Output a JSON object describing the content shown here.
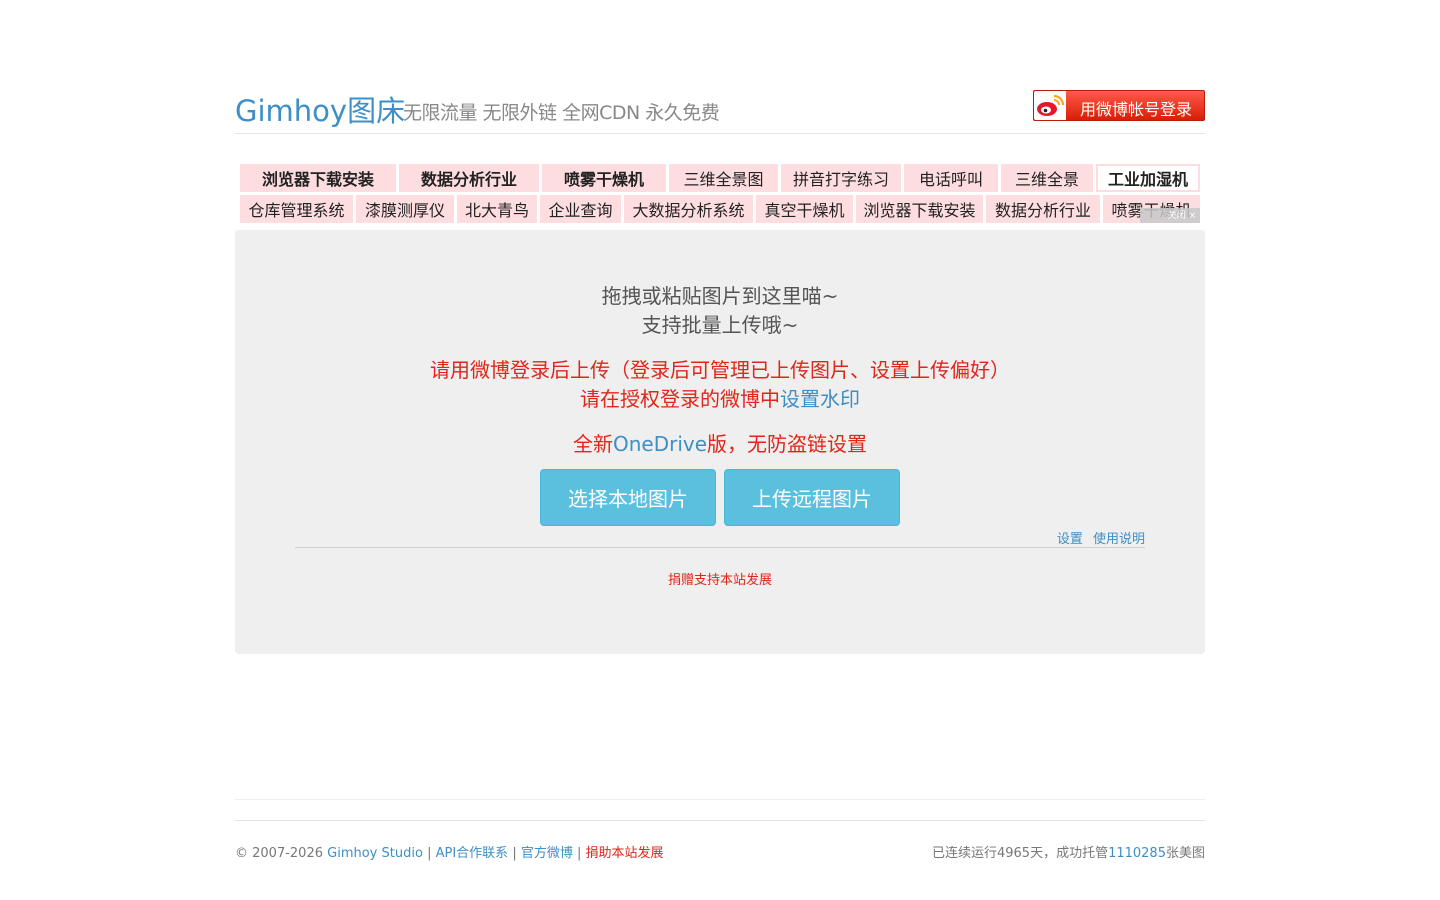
{
  "header": {
    "brand": "Gimhoy图床",
    "slogan": "无限流量 无限外链 全网CDN 永久免费",
    "login_button": "用微博帐号登录"
  },
  "ads": {
    "row1": [
      "浏览器下载安装",
      "数据分析行业",
      "喷雾干燥机",
      "三维全景图",
      "拼音打字练习",
      "电话呼叫",
      "三维全景",
      "工业加湿机"
    ],
    "row2": [
      "仓库管理系统",
      "漆膜测厚仪",
      "北大青鸟",
      "企业查询",
      "大数据分析系统",
      "真空干燥机",
      "浏览器下载安装",
      "数据分析行业",
      "喷雾干燥机"
    ],
    "close_label": "关闭 ×"
  },
  "upload": {
    "drag_text": "拖拽或粘贴图片到这里喵~",
    "batch_text": "支持批量上传哦~",
    "login_notice": "请用微博登录后上传（登录后可管理已上传图片、设置上传偏好）",
    "watermark_prefix": "请在授权登录的微博中",
    "watermark_link": "设置水印",
    "onedrive_prefix": "全新",
    "onedrive_link": "OneDrive",
    "onedrive_suffix": "版，无防盗链设置",
    "select_local": "选择本地图片",
    "upload_remote": "上传远程图片",
    "settings": "设置",
    "help": "使用说明",
    "donate": "捐赠支持本站发展"
  },
  "footer": {
    "copyright": "© 2007-2026",
    "studio": "Gimhoy Studio",
    "sep": "|",
    "api": "API合作联系",
    "weibo": "官方微博",
    "donate": "捐助本站发展",
    "stats_prefix": "已连续运行4965天，成功托管",
    "stats_count": "1110285",
    "stats_suffix": "张美图"
  },
  "colors": {
    "brand_blue": "#3d8fc6",
    "accent_red": "#e0261a",
    "button_cyan": "#5bc0de",
    "ad_pink": "#fddde0",
    "panel_bg": "#efefef"
  }
}
